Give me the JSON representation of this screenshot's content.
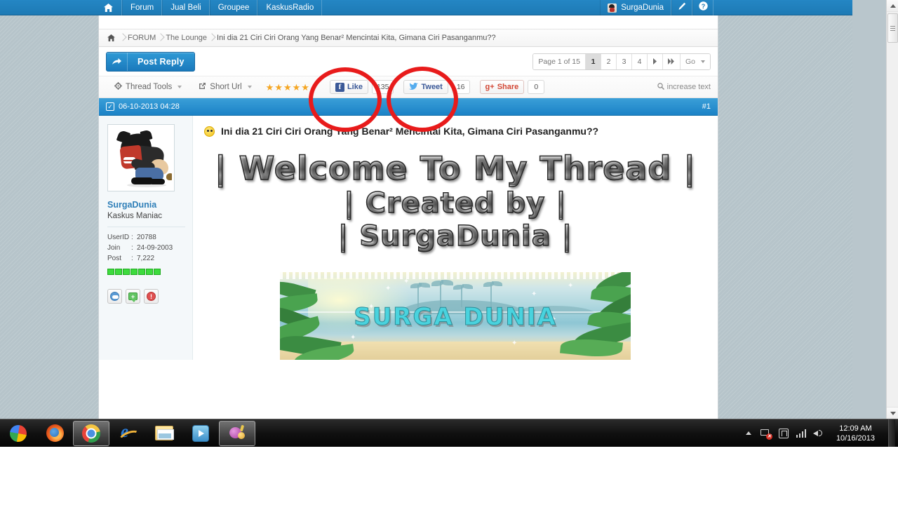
{
  "topnav": {
    "home_icon": "home-icon",
    "items": [
      {
        "label": "Forum"
      },
      {
        "label": "Jual Beli"
      },
      {
        "label": "Groupee"
      },
      {
        "label": "KaskusRadio"
      }
    ],
    "user": {
      "name": "SurgaDunia",
      "avatar_icon": "user-avatar"
    },
    "compose_icon": "pencil-icon",
    "help_icon": "question-mark-icon",
    "bg_color": "#2486c4"
  },
  "breadcrumb": {
    "home_icon": "home-icon",
    "items": [
      {
        "label": "FORUM"
      },
      {
        "label": "The Lounge"
      },
      {
        "label": "Ini dia 21 Ciri Ciri Orang Yang Benar² Mencintai Kita, Gimana Ciri Pasanganmu??"
      }
    ]
  },
  "actionbar": {
    "post_reply_label": "Post Reply",
    "post_reply_icon": "reply-arrow-icon",
    "pagination": {
      "page_label": "Page 1 of 15",
      "pages": [
        "1",
        "2",
        "3",
        "4"
      ],
      "current_page": "1",
      "next_icon": "chevron-right-icon",
      "last_icon": "double-chevron-right-icon",
      "go_label": "Go"
    }
  },
  "tools": {
    "thread_tools_label": "Thread Tools",
    "thread_tools_icon": "gear-icon",
    "short_url_label": "Short Url",
    "short_url_icon": "external-link-icon",
    "rating_stars": 5,
    "star_glyph": "★",
    "social": [
      {
        "name": "facebook-like",
        "label": "Like",
        "count": "135",
        "icon": "facebook-icon",
        "glyph": "f"
      },
      {
        "name": "twitter-tweet",
        "label": "Tweet",
        "count": "16",
        "icon": "twitter-bird-icon",
        "glyph": "🐦"
      },
      {
        "name": "google-share",
        "label": "Share",
        "count": "0",
        "icon": "google-plus-icon",
        "glyph": "g+"
      }
    ],
    "increase_text_label": "increase text",
    "increase_text_icon": "magnifier-icon"
  },
  "post": {
    "date": "06-10-2013 04:28",
    "date_icon": "checked-box-icon",
    "number": "#1",
    "title": "Ini dia 21 Ciri Ciri Orang Yang Benar² Mencintai Kita, Gimana Ciri Pasanganmu??",
    "title_emoji": "smiley-emoticon",
    "author": {
      "username": "SurgaDunia",
      "usertitle": "Kaskus Maniac",
      "avatar_icon": "member-avatar",
      "stats": [
        {
          "key": "UserID",
          "sep": ":",
          "value": "20788"
        },
        {
          "key": "Join",
          "sep": ":",
          "value": "24-09-2003"
        },
        {
          "key": "Post",
          "sep": ":",
          "value": "7,222"
        }
      ],
      "reputation_blocks": 7,
      "buttons": [
        {
          "name": "view-profile-button",
          "icon": "profile-icon"
        },
        {
          "name": "give-reputation-button",
          "icon": "green-plus-bubble-icon"
        },
        {
          "name": "report-post-button",
          "icon": "red-exclamation-icon"
        }
      ]
    },
    "text_art": {
      "line1": "| Welcome To My Thread |",
      "line2": "| Created by |",
      "line3": "| SurgaDunia |"
    },
    "banner": {
      "title": "SURGA DUNIA",
      "alt": "tropical-beach-banner"
    }
  },
  "annotations": [
    {
      "name": "annotation-circle-like",
      "target": "facebook-like-button",
      "color": "#e81b1b"
    },
    {
      "name": "annotation-circle-tweet",
      "target": "twitter-tweet-button",
      "color": "#e81b1b"
    }
  ],
  "taskbar": {
    "apps": [
      {
        "name": "google-orb-icon",
        "active": false
      },
      {
        "name": "firefox-icon",
        "active": false
      },
      {
        "name": "chrome-icon",
        "active": true
      },
      {
        "name": "internet-explorer-icon",
        "active": false
      },
      {
        "name": "file-explorer-icon",
        "active": false
      },
      {
        "name": "windows-media-player-icon",
        "active": false
      },
      {
        "name": "purple-app-icon",
        "active": true
      }
    ],
    "tray": [
      {
        "name": "show-hidden-icons",
        "icon": "triangle-up-icon"
      },
      {
        "name": "network-status-icon",
        "icon": "network-error-icon"
      },
      {
        "name": "action-center-icon",
        "icon": "flag-icon"
      },
      {
        "name": "signal-strength-icon",
        "icon": "bars-icon"
      },
      {
        "name": "volume-icon",
        "icon": "speaker-icon"
      }
    ],
    "clock": {
      "time": "12:09 AM",
      "date": "10/16/2013"
    }
  },
  "scrollbar": {
    "up_icon": "triangle-up-icon",
    "down_icon": "triangle-down-icon",
    "thumb_position": "top"
  }
}
